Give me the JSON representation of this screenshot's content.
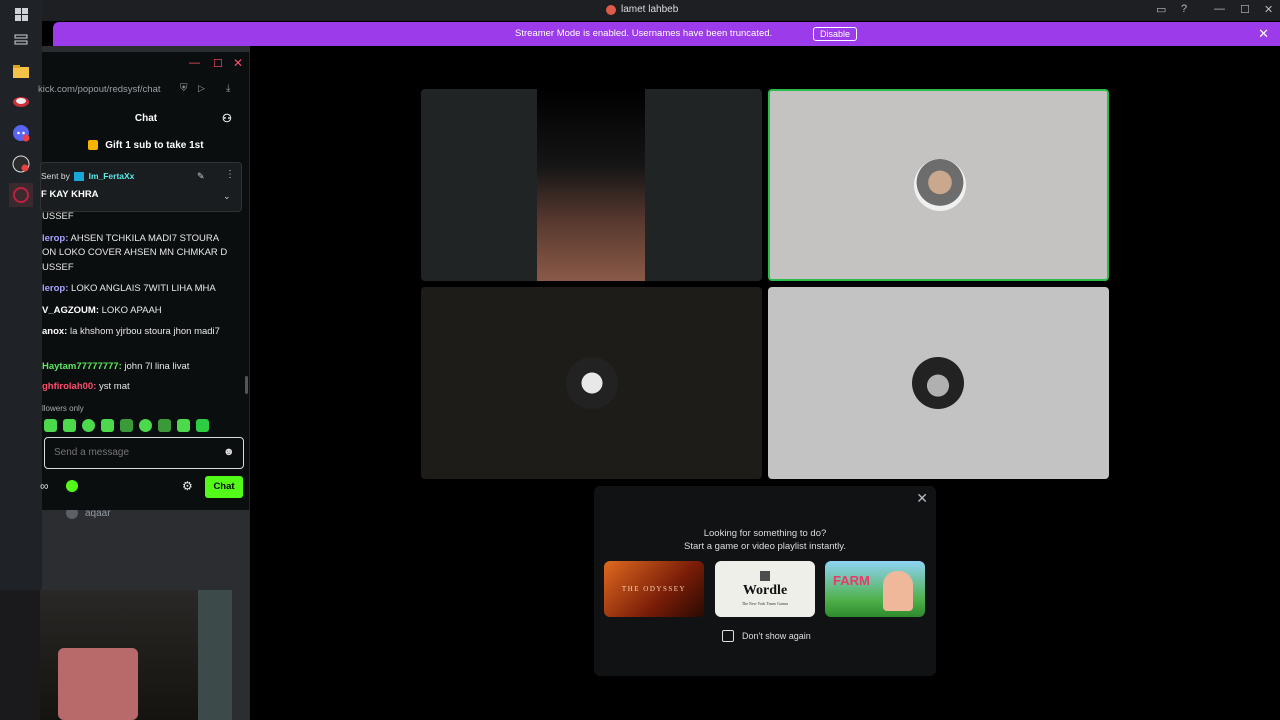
{
  "titlebar": {
    "title": "lamet lahbeb"
  },
  "banner": {
    "message": "Streamer Mode is enabled. Usernames have been truncated.",
    "disable_label": "Disable"
  },
  "chat": {
    "url": "kick.com/popout/redsysf/chat",
    "header": "Chat",
    "gift": "Gift 1 sub to take 1st",
    "pinned_by_prefix": "Sent by",
    "pinned_by_user": "Im_FertaXx",
    "pinned_text": "F KAY KHRA",
    "messages": [
      {
        "user": "",
        "text": "USSEF"
      },
      {
        "user": "lerop:",
        "text": "AHSEN TCHKILA MADI7 STOURA"
      },
      {
        "user": "",
        "text": "ON LOKO COVER AHSEN MN CHMKAR D"
      },
      {
        "user": "",
        "text": "USSEF"
      },
      {
        "user": "lerop:",
        "text": "LOKO ANGLAIS 7WITI LIHA MHA"
      },
      {
        "user": "V_AGZOUM:",
        "text": "LOKO APAAH"
      },
      {
        "user": "anox:",
        "text": "la khshom yjrbou stoura jhon madi7"
      },
      {
        "user": "Haytam77777777:",
        "text": "john 7l lina livat"
      },
      {
        "user": "ghfirolah00:",
        "text": "yst mat"
      }
    ],
    "followers_only": "llowers only",
    "input_placeholder": "Send a message",
    "chat_button": "Chat"
  },
  "voice": {
    "user": "aqaar"
  },
  "activity": {
    "line1": "Looking for something to do?",
    "line2": "Start a game or video playlist instantly.",
    "cards": [
      "THE ODYSSEY",
      "Wordle",
      "FARM"
    ],
    "wordle_sub": "The New York Times Games",
    "dont_show": "Don't show again"
  }
}
